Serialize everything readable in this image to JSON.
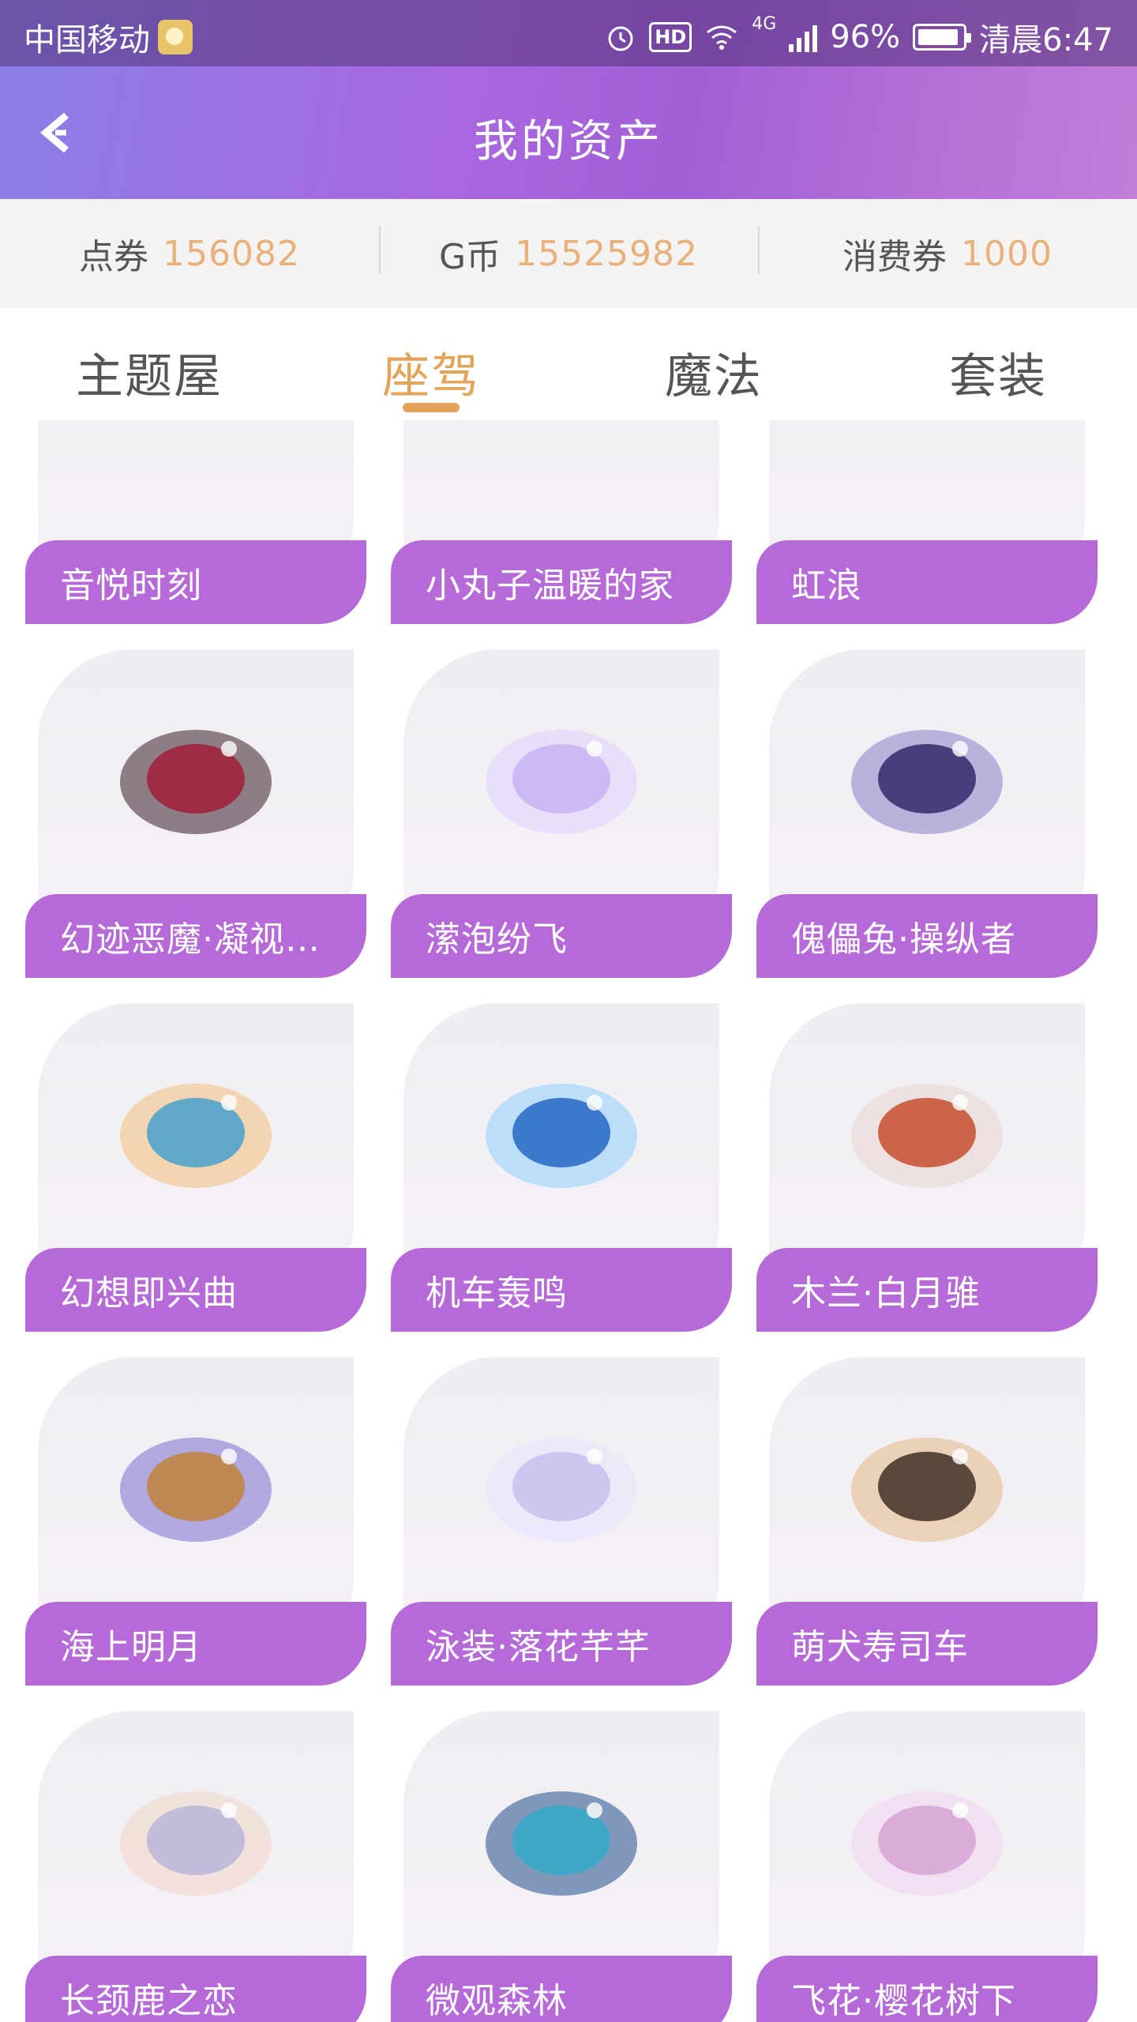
{
  "status_bar": {
    "carrier": "中国移动",
    "hd": "HD",
    "network": "4G",
    "battery": "96%",
    "time": "清晨6:47"
  },
  "header": {
    "title": "我的资产",
    "back_icon": "back-arrow-icon"
  },
  "balances": [
    {
      "label": "点券",
      "value": "156082"
    },
    {
      "label": "G币",
      "value": "15525982"
    },
    {
      "label": "消费券",
      "value": "1000"
    }
  ],
  "tabs": [
    {
      "label": "主题屋",
      "active": false
    },
    {
      "label": "座驾",
      "active": true
    },
    {
      "label": "魔法",
      "active": false
    },
    {
      "label": "套装",
      "active": false
    }
  ],
  "items": [
    {
      "name": "音悦时刻"
    },
    {
      "name": "小丸子温暖的家"
    },
    {
      "name": "虹浪"
    },
    {
      "name": "幻迹恶魔·凝视之眼"
    },
    {
      "name": "潆泡纷飞"
    },
    {
      "name": "傀儡兔·操纵者"
    },
    {
      "name": "幻想即兴曲"
    },
    {
      "name": "机车轰鸣"
    },
    {
      "name": "木兰·白月骓"
    },
    {
      "name": "海上明月"
    },
    {
      "name": "泳装·落花芊芊"
    },
    {
      "name": "萌犬寿司车"
    },
    {
      "name": "长颈鹿之恋"
    },
    {
      "name": "微观森林"
    },
    {
      "name": "飞花·樱花树下"
    }
  ],
  "colors": {
    "accent": "#e3a45a",
    "label_bar": "#b56ad7",
    "balance_value": "#e8b07a"
  }
}
